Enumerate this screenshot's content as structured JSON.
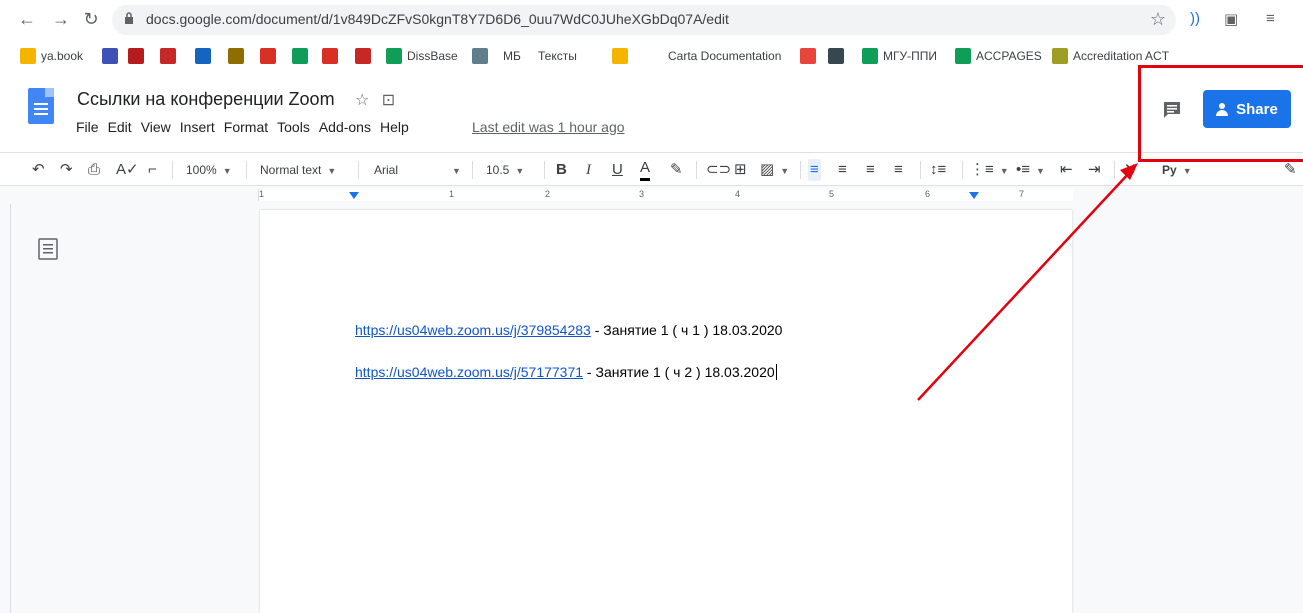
{
  "browser": {
    "url": "docs.google.com/document/d/1v849DcZFvS0kgnT8Y7D6D6_0uu7WdC0JUheXGbDq07A/edit"
  },
  "bookmarks": [
    {
      "label": "ya.book",
      "color": "#f4b400"
    },
    {
      "label": "",
      "color": "#3f51b5"
    },
    {
      "label": "",
      "color": "#b71c1c"
    },
    {
      "label": "",
      "color": "#c62828"
    },
    {
      "label": "",
      "color": "#1565c0"
    },
    {
      "label": "",
      "color": "#8d6e00"
    },
    {
      "label": "",
      "color": "#d93025"
    },
    {
      "label": "",
      "color": "#0f9d58"
    },
    {
      "label": "",
      "color": "#d93025"
    },
    {
      "label": "",
      "color": "#c62828"
    },
    {
      "label": "DissBase",
      "color": "#0f9d58"
    },
    {
      "label": "",
      "color": "#607d8b"
    },
    {
      "label": "МБ",
      "color": "#ffffff"
    },
    {
      "label": "Тексты",
      "color": "#ffffff"
    },
    {
      "label": "",
      "color": "#f4b400"
    },
    {
      "label": "Carta Documentation",
      "color": "#ffffff"
    },
    {
      "label": "",
      "color": "#e8453c"
    },
    {
      "label": "",
      "color": "#37474f"
    },
    {
      "label": "МГУ-ППИ",
      "color": "#0f9d58"
    },
    {
      "label": "ACCPAGES",
      "color": "#0f9d58"
    },
    {
      "label": "Accreditation ACT",
      "color": "#9e9d24"
    }
  ],
  "doc": {
    "title": "Ссылки на конференции Zoom",
    "menu": [
      "File",
      "Edit",
      "View",
      "Insert",
      "Format",
      "Tools",
      "Add-ons",
      "Help"
    ],
    "last_edit": "Last edit was 1 hour ago",
    "share_label": "Share"
  },
  "toolbar": {
    "zoom": "100%",
    "style": "Normal text",
    "font": "Arial",
    "size": "10.5",
    "bold": "B",
    "italic": "I",
    "underline": "U",
    "text_color": "A",
    "lang": "Ру"
  },
  "ruler": [
    "1",
    "1",
    "2",
    "3",
    "4",
    "5",
    "6",
    "7"
  ],
  "content": {
    "lines": [
      {
        "link": "https://us04web.zoom.us/j/379854283",
        "text": " - Занятие 1 ( ч 1 ) 18.03.2020"
      },
      {
        "link": "https://us04web.zoom.us/j/57177371",
        "text": " - Занятие 1 ( ч 2 ) 18.03.2020"
      }
    ]
  },
  "colors": {
    "accent": "#1a73e8",
    "annotation": "#e3000f",
    "link": "#1155cc"
  }
}
